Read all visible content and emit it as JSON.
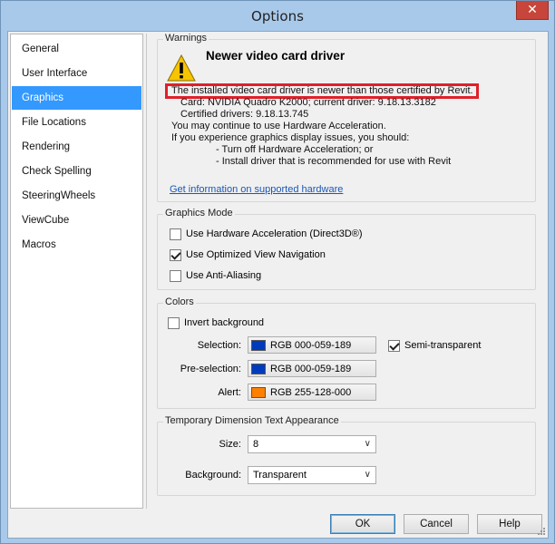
{
  "window": {
    "title": "Options",
    "close_glyph": "✕"
  },
  "nav": {
    "items": [
      {
        "label": "General",
        "selected": false
      },
      {
        "label": "User Interface",
        "selected": false
      },
      {
        "label": "Graphics",
        "selected": true
      },
      {
        "label": "File Locations",
        "selected": false
      },
      {
        "label": "Rendering",
        "selected": false
      },
      {
        "label": "Check Spelling",
        "selected": false
      },
      {
        "label": "SteeringWheels",
        "selected": false
      },
      {
        "label": "ViewCube",
        "selected": false
      },
      {
        "label": "Macros",
        "selected": false
      }
    ]
  },
  "warnings": {
    "group_label": "Warnings",
    "icon": "warning-triangle-icon",
    "title": "Newer video card driver",
    "highlighted_line": "The installed video card driver is newer than those certified by Revit.",
    "card_line": "Card: NVIDIA Quadro K2000; current driver: 9.18.13.3182",
    "certified_line": "Certified drivers: 9.18.13.745",
    "continue_line": "You may continue to use Hardware Acceleration.",
    "issues_line": "If you experience graphics display issues, you should:",
    "option1": "- Turn off Hardware Acceleration; or",
    "option2": "- Install driver that is recommended for use with Revit",
    "link": "Get information on supported hardware"
  },
  "graphics_mode": {
    "group_label": "Graphics Mode",
    "hardware_accel": {
      "label": "Use Hardware Acceleration (Direct3D®)",
      "checked": false
    },
    "optimized_nav": {
      "label": "Use Optimized View Navigation",
      "checked": true
    },
    "anti_alias": {
      "label": "Use Anti-Aliasing",
      "checked": false
    }
  },
  "colors": {
    "group_label": "Colors",
    "invert_bg": {
      "label": "Invert background",
      "checked": false
    },
    "selection": {
      "label": "Selection:",
      "value": "RGB 000-059-189",
      "color": "#003bbd"
    },
    "semi_transparent": {
      "label": "Semi-transparent",
      "checked": true
    },
    "preselection": {
      "label": "Pre-selection:",
      "value": "RGB 000-059-189",
      "color": "#003bbd"
    },
    "alert": {
      "label": "Alert:",
      "value": "RGB 255-128-000",
      "color": "#ff8000"
    }
  },
  "temp_dim": {
    "group_label": "Temporary Dimension Text Appearance",
    "size_label": "Size:",
    "size_value": "8",
    "background_label": "Background:",
    "background_value": "Transparent",
    "chevron": "∨"
  },
  "footer": {
    "ok": "OK",
    "cancel": "Cancel",
    "help": "Help"
  }
}
